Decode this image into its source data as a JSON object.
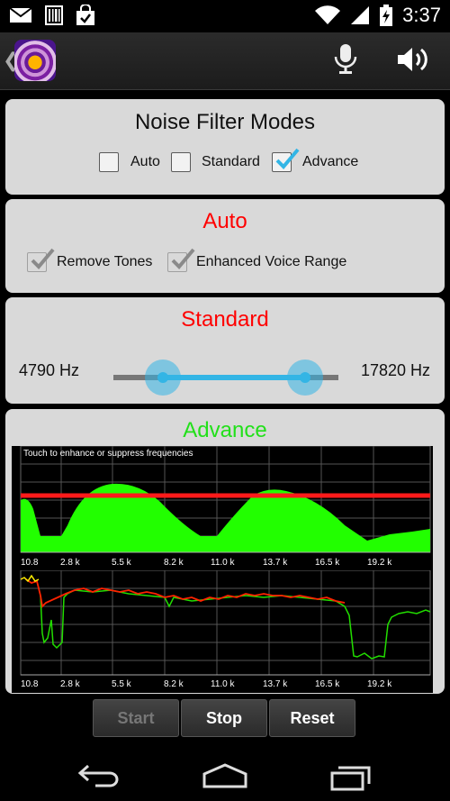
{
  "status_bar": {
    "time": "3:37"
  },
  "modes": {
    "title": "Noise Filter Modes",
    "options": [
      {
        "label": "Auto",
        "checked": false
      },
      {
        "label": "Standard",
        "checked": false
      },
      {
        "label": "Advance",
        "checked": true
      }
    ]
  },
  "auto": {
    "title": "Auto",
    "options": [
      {
        "label": "Remove Tones",
        "checked": true
      },
      {
        "label": "Enhanced Voice Range",
        "checked": true
      }
    ]
  },
  "standard": {
    "title": "Standard",
    "low_label": "4790 Hz",
    "high_label": "17820 Hz",
    "low_value": 0.22,
    "high_value": 0.85
  },
  "advance": {
    "title": "Advance",
    "note": "Touch to enhance or suppress frequencies",
    "ticks": [
      "10.8",
      "2.8 k",
      "5.5 k",
      "8.2 k",
      "11.0 k",
      "13.7 k",
      "16.5 k",
      "19.2 k"
    ]
  },
  "controls": {
    "start": "Start",
    "stop": "Stop",
    "reset": "Reset"
  },
  "colors": {
    "accent": "#33b5e5",
    "title_red": "#ff0000",
    "title_green": "#22e01a",
    "spectrum_fill": "#22ff00",
    "threshold_line": "#ff1a1a"
  }
}
